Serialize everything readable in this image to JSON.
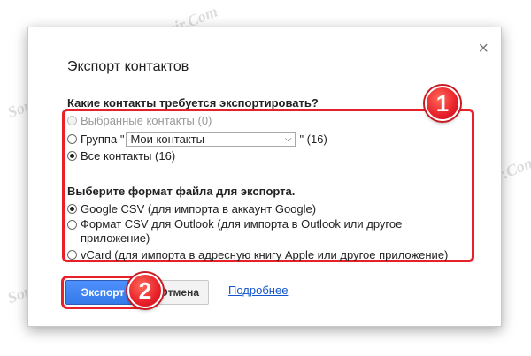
{
  "dialog": {
    "title": "Экспорт контактов",
    "close_glyph": "×"
  },
  "which_contacts": {
    "label": "Какие контакты требуется экспортировать?",
    "options": [
      {
        "label": "Выбранные контакты (0)",
        "checked": false,
        "disabled": true
      },
      {
        "prefix": "Группа \"",
        "select_value": "Мои контакты",
        "suffix": "\" (16)",
        "checked": false,
        "disabled": false
      },
      {
        "label": "Все контакты (16)",
        "checked": true,
        "disabled": false
      }
    ]
  },
  "file_format": {
    "label": "Выберите формат файла для экспорта.",
    "options": [
      {
        "label": "Google CSV (для импорта в аккаунт Google)",
        "checked": true
      },
      {
        "label": "Формат CSV для Outlook (для импорта в Outlook или другое приложение)",
        "checked": false
      },
      {
        "label": "vCard (для импорта в адресную книгу Apple или другое приложение)",
        "checked": false
      }
    ]
  },
  "buttons": {
    "export": "Экспорт",
    "cancel": "Отмена",
    "more_link": "Подробнее"
  },
  "annotations": {
    "badge_1": "1",
    "badge_2": "2"
  },
  "watermark_text": "Soringpcrepair.Com",
  "colors": {
    "accent_red": "#e8202a",
    "primary_blue": "#4d90fe",
    "link_blue": "#1155cc"
  }
}
